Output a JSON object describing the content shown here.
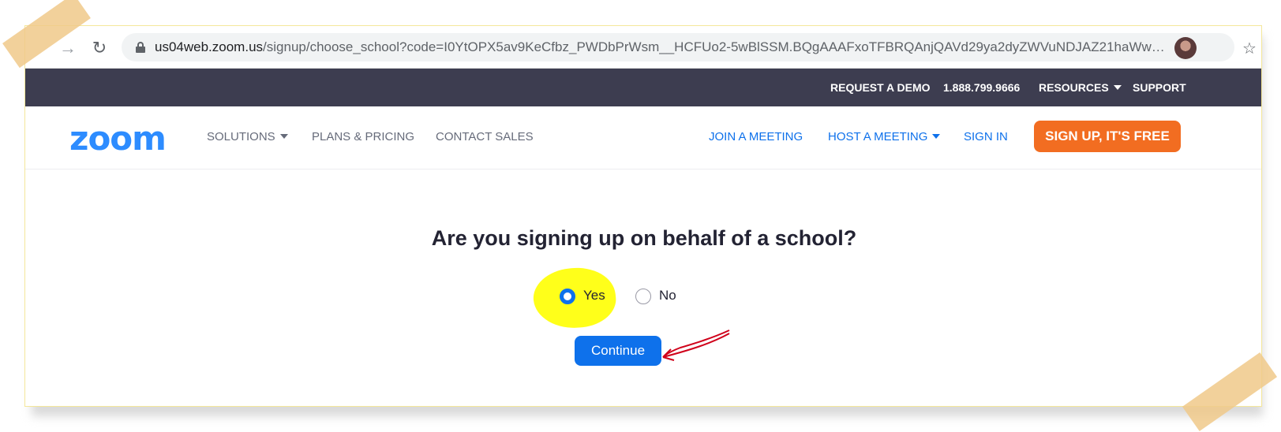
{
  "browser": {
    "url_domain": "us04web.zoom.us",
    "url_path": "/signup/choose_school?code=I0YtOPX5av9KeCfbz_PWDbPrWsm__HCFUo2-5wBlSSM.BQgAAAFxoTFBRQAnjQAVd29ya2dyZWVuNDJAZ21haWwuY..."
  },
  "top_strip": {
    "request_demo": "REQUEST A DEMO",
    "phone": "1.888.799.9666",
    "resources": "RESOURCES",
    "support": "SUPPORT"
  },
  "nav": {
    "logo": "zoom",
    "solutions": "SOLUTIONS",
    "plans": "PLANS & PRICING",
    "contact": "CONTACT SALES",
    "join": "JOIN A MEETING",
    "host": "HOST A MEETING",
    "signin": "SIGN IN",
    "signup": "SIGN UP, IT'S FREE"
  },
  "form": {
    "question": "Are you signing up on behalf of a school?",
    "options": [
      {
        "label": "Yes",
        "selected": true
      },
      {
        "label": "No",
        "selected": false
      }
    ],
    "continue_label": "Continue"
  },
  "colors": {
    "zoom_blue": "#2d8cff",
    "link_blue": "#0e71eb",
    "signup_orange": "#f26d21",
    "top_strip_bg": "#3d3d50",
    "highlight": "#ffff1a",
    "annotation_arrow": "#d0021b"
  },
  "icons": {
    "forward": "arrow-right-icon",
    "reload": "reload-icon",
    "lock": "lock-icon",
    "bookmark": "star-icon",
    "profile": "avatar"
  }
}
